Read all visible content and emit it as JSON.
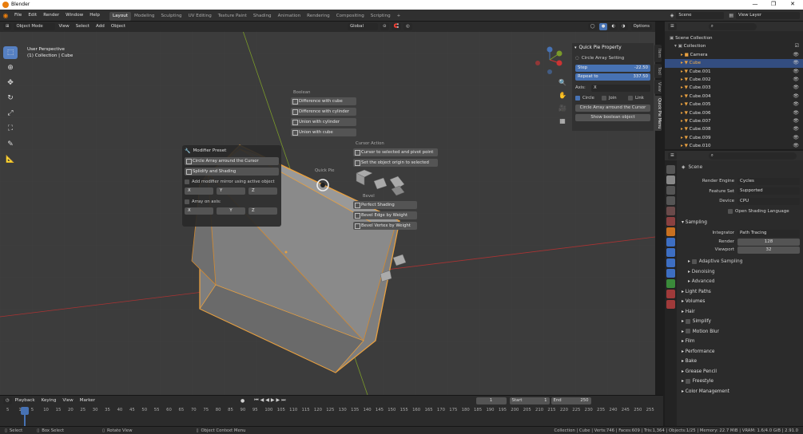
{
  "window": {
    "title": "Blender",
    "min": "—",
    "max": "❐",
    "close": "✕"
  },
  "menu": [
    "File",
    "Edit",
    "Render",
    "Window",
    "Help"
  ],
  "workspaces": [
    "Layout",
    "Modeling",
    "Sculpting",
    "UV Editing",
    "Texture Paint",
    "Shading",
    "Animation",
    "Rendering",
    "Compositing",
    "Scripting",
    "+"
  ],
  "scene": {
    "label": "Scene",
    "view_layer": "View Layer"
  },
  "vp_header": {
    "mode": "Object Mode",
    "view": "View",
    "select": "Select",
    "add": "Add",
    "object": "Object",
    "transform": "Global",
    "options": "Options"
  },
  "vp_overlay": {
    "perspective": "User Perspective",
    "collection": "(1) Collection | Cube"
  },
  "pie": {
    "title": "Quick Pie",
    "boolean_label": "Boolean",
    "boolean": [
      "Difference with cube",
      "Difference with cylinder",
      "Union with cylinder",
      "Union with cube"
    ],
    "cursor_label": "Cursor Action",
    "cursor": [
      "Cursor to selected and pivot point",
      "Set the object origin to selected"
    ],
    "modifier_title": "Modifier Preset",
    "modifier": [
      "Circle Array arround the Cursor",
      "Splidify and Shading"
    ],
    "mirror_label": "Add modifier mirror using active object",
    "mirror_axes": [
      "X",
      "Y",
      "Z"
    ],
    "array_label": "Array on axis:",
    "array_axes": [
      "X",
      "Y",
      "Z"
    ],
    "bevel_label": "Bevel",
    "bevel": [
      "Perfect Shading",
      "Bevel Edge by Weight",
      "Bevel Vertex by Weight"
    ]
  },
  "npanel": {
    "title": "Quick Pie Property",
    "section": "Circle Array Setting",
    "step_label": "Step",
    "step": "-22.50",
    "repeat_label": "Repeat to",
    "repeat": "337.50",
    "axis_label": "Axis:",
    "axis": "X",
    "circle": "Circle",
    "join": "Join",
    "link": "Link",
    "btn1": "Circle Array arround the Cursor",
    "btn2": "Show boolean object",
    "tabs": [
      "Item",
      "Tool",
      "View",
      "Quick Pie Menu"
    ]
  },
  "outliner": {
    "root": "Scene Collection",
    "collection": "Collection",
    "items": [
      "Camera",
      "Cube",
      "Cube.001",
      "Cube.002",
      "Cube.003",
      "Cube.004",
      "Cube.005",
      "Cube.006",
      "Cube.007",
      "Cube.008",
      "Cube.009",
      "Cube.010"
    ]
  },
  "properties": {
    "scene": "Scene",
    "render_engine_label": "Render Engine",
    "render_engine": "Cycles",
    "feature_set_label": "Feature Set",
    "feature_set": "Supported",
    "device_label": "Device",
    "device": "CPU",
    "osl": "Open Shading Language",
    "sampling": "Sampling",
    "integrator_label": "Integrator",
    "integrator": "Path Tracing",
    "render_label": "Render",
    "render": "128",
    "viewport_label": "Viewport",
    "viewport": "32",
    "adaptive": "Adaptive Sampling",
    "denoising": "Denoising",
    "advanced": "Advanced",
    "sections": [
      "Light Paths",
      "Volumes",
      "Hair",
      "Simplify",
      "Motion Blur",
      "Film",
      "Performance",
      "Bake",
      "Grease Pencil",
      "Freestyle",
      "Color Management"
    ]
  },
  "timeline": {
    "playback": "Playback",
    "keying": "Keying",
    "view": "View",
    "marker": "Marker",
    "frame": "1",
    "start_label": "Start",
    "start": "1",
    "end_label": "End",
    "end": "250",
    "ticks": [
      "5",
      "1",
      "5",
      "10",
      "15",
      "20",
      "25",
      "30",
      "35",
      "40",
      "45",
      "50",
      "55",
      "60",
      "65",
      "70",
      "75",
      "80",
      "85",
      "90",
      "95",
      "100",
      "105",
      "110",
      "115",
      "120",
      "125",
      "130",
      "135",
      "140",
      "145",
      "150",
      "155",
      "160",
      "165",
      "170",
      "175",
      "180",
      "185",
      "190",
      "195",
      "200",
      "205",
      "210",
      "215",
      "220",
      "225",
      "230",
      "235",
      "240",
      "245",
      "250",
      "255"
    ]
  },
  "status": {
    "select": "Select",
    "box_select": "Box Select",
    "rotate": "Rotate View",
    "context": "Object Context Menu",
    "info": "Collection | Cube | Verts:746 | Faces:609 | Tris:1,364 | Objects:1/25 | Memory: 22.7 MiB | VRAM: 1.6/4.0 GiB | 2.91.0"
  },
  "colors": {
    "accent": "#4772b3",
    "selected": "#e8a040",
    "bg": "#3c3c3c"
  }
}
